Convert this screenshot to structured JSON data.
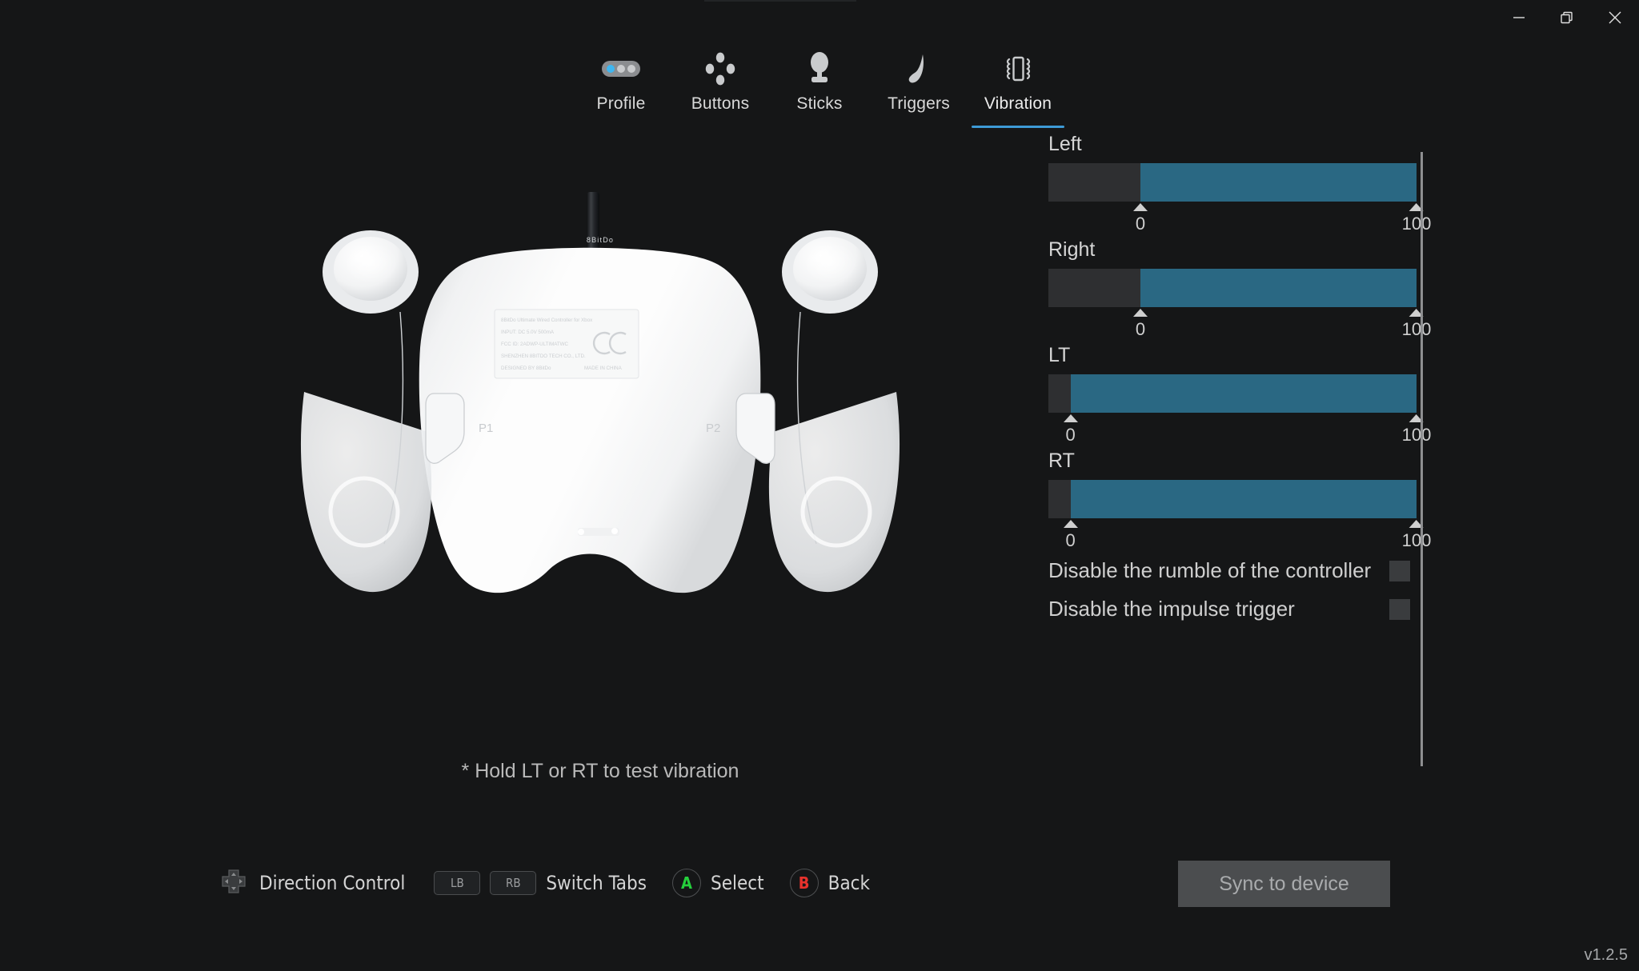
{
  "window": {
    "controls": [
      {
        "name": "minimize",
        "glyph": "minimize-icon"
      },
      {
        "name": "restore",
        "glyph": "restore-icon"
      },
      {
        "name": "close",
        "glyph": "close-icon"
      }
    ]
  },
  "tabs": [
    {
      "id": "profile",
      "label": "Profile",
      "icon": "profile-pill-icon",
      "active": false
    },
    {
      "id": "buttons",
      "label": "Buttons",
      "icon": "dpad-diamond-icon",
      "active": false
    },
    {
      "id": "sticks",
      "label": "Sticks",
      "icon": "analog-stick-icon",
      "active": false
    },
    {
      "id": "triggers",
      "label": "Triggers",
      "icon": "trigger-icon",
      "active": false
    },
    {
      "id": "vibration",
      "label": "Vibration",
      "icon": "vibration-icon",
      "active": true
    }
  ],
  "main": {
    "controller_image_alt": "8BitDo Ultimate Wired Controller rear view",
    "controller_labels": {
      "paddle_left": "P1",
      "paddle_right": "P2",
      "plate_line1": "8BitDo Ultimate Wired Controller for Xbox",
      "plate_line2": "INPUT: DC 5.0V 500mA",
      "plate_line3": "FCC ID: 2ADWP-ULTIMATWC",
      "plate_line4": "SHENZHEN 8BITDO TECH CO., LTD.",
      "plate_line5": "DESIGNED BY 8BitDo",
      "plate_line6": "MADE IN CHINA",
      "brand": "8BitDo"
    },
    "hint_note": "* Hold LT or RT to test vibration"
  },
  "vibration_panel": {
    "accent_color": "#2a6883",
    "track_color": "#2e2f31",
    "sliders": [
      {
        "id": "left",
        "label": "Left",
        "min_label": "0",
        "max_label": "100",
        "fill_start_pct": 25,
        "fill_end_pct": 100,
        "value": 100,
        "min": 0,
        "max": 100
      },
      {
        "id": "right",
        "label": "Right",
        "min_label": "0",
        "max_label": "100",
        "fill_start_pct": 25,
        "fill_end_pct": 100,
        "value": 100,
        "min": 0,
        "max": 100
      },
      {
        "id": "lt",
        "label": "LT",
        "min_label": "0",
        "max_label": "100",
        "fill_start_pct": 6,
        "fill_end_pct": 100,
        "value": 100,
        "min": 0,
        "max": 100
      },
      {
        "id": "rt",
        "label": "RT",
        "min_label": "0",
        "max_label": "100",
        "fill_start_pct": 6,
        "fill_end_pct": 100,
        "value": 100,
        "min": 0,
        "max": 100
      }
    ],
    "checkboxes": [
      {
        "id": "disable-rumble",
        "label": "Disable the rumble of the controller",
        "checked": false
      },
      {
        "id": "disable-impulse",
        "label": "Disable the impulse trigger",
        "checked": false
      }
    ]
  },
  "footer": {
    "hints": [
      {
        "id": "direction",
        "icon": "dpad-icon",
        "label": "Direction Control"
      },
      {
        "id": "switch-tabs",
        "keys": [
          "LB",
          "RB"
        ],
        "label": "Switch Tabs"
      },
      {
        "id": "select",
        "button": "A",
        "label": "Select"
      },
      {
        "id": "back",
        "button": "B",
        "label": "Back"
      }
    ],
    "sync_button": "Sync to device",
    "version": "v1.2.5"
  }
}
